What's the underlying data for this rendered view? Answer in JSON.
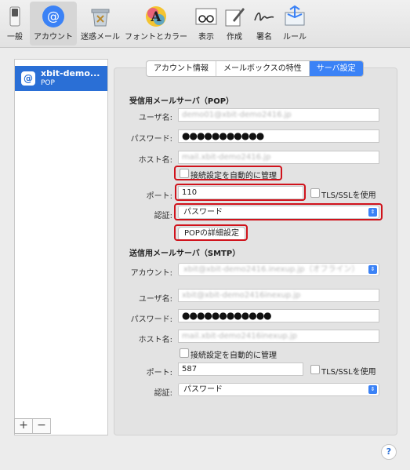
{
  "toolbar": {
    "items": [
      {
        "label": "一般",
        "icon": "switch-icon"
      },
      {
        "label": "アカウント",
        "icon": "at-icon"
      },
      {
        "label": "迷惑メール",
        "icon": "junk-mail-icon"
      },
      {
        "label": "フォントとカラー",
        "icon": "font-color-icon"
      },
      {
        "label": "表示",
        "icon": "glasses-icon"
      },
      {
        "label": "作成",
        "icon": "compose-icon"
      },
      {
        "label": "署名",
        "icon": "signature-icon"
      },
      {
        "label": "ルール",
        "icon": "rules-icon"
      }
    ]
  },
  "sidebar": {
    "account_name": "xbit-demo...",
    "account_type": "POP",
    "add_label": "+",
    "remove_label": "−"
  },
  "tabs": [
    "アカウント情報",
    "メールボックスの特性",
    "サーバ設定"
  ],
  "incoming": {
    "heading": "受信用メールサーバ（POP）",
    "username_label": "ユーザ名:",
    "username_value": "demo01@xbit-demo2416.jp",
    "password_label": "パスワード:",
    "password_value": "●●●●●●●●●●●",
    "host_label": "ホスト名:",
    "host_value": "mail.xbit-demo2416.jp",
    "auto_manage_label": "接続設定を自動的に管理",
    "port_label": "ポート:",
    "port_value": "110",
    "tls_label": "TLS/SSLを使用",
    "auth_label": "認証:",
    "auth_value": "パスワード",
    "advanced_button": "POPの詳細設定"
  },
  "outgoing": {
    "heading": "送信用メールサーバ（SMTP）",
    "account_label": "アカウント:",
    "account_value": "xbit@xbit-demo2416.inexup.jp（オフライン）",
    "username_label": "ユーザ名:",
    "username_value": "xbit@xbit-demo2416inexup.jp",
    "password_label": "パスワード:",
    "password_value": "●●●●●●●●●●●●",
    "host_label": "ホスト名:",
    "host_value": "mail.xbit-demo2416inexup.jp",
    "auto_manage_label": "接続設定を自動的に管理",
    "port_label": "ポート:",
    "port_value": "587",
    "tls_label": "TLS/SSLを使用",
    "auth_label": "認証:",
    "auth_value": "パスワード"
  },
  "help_label": "?",
  "colors": {
    "accent": "#3b82f6",
    "highlight": "#d0121b",
    "selection": "#2a6fd6"
  }
}
